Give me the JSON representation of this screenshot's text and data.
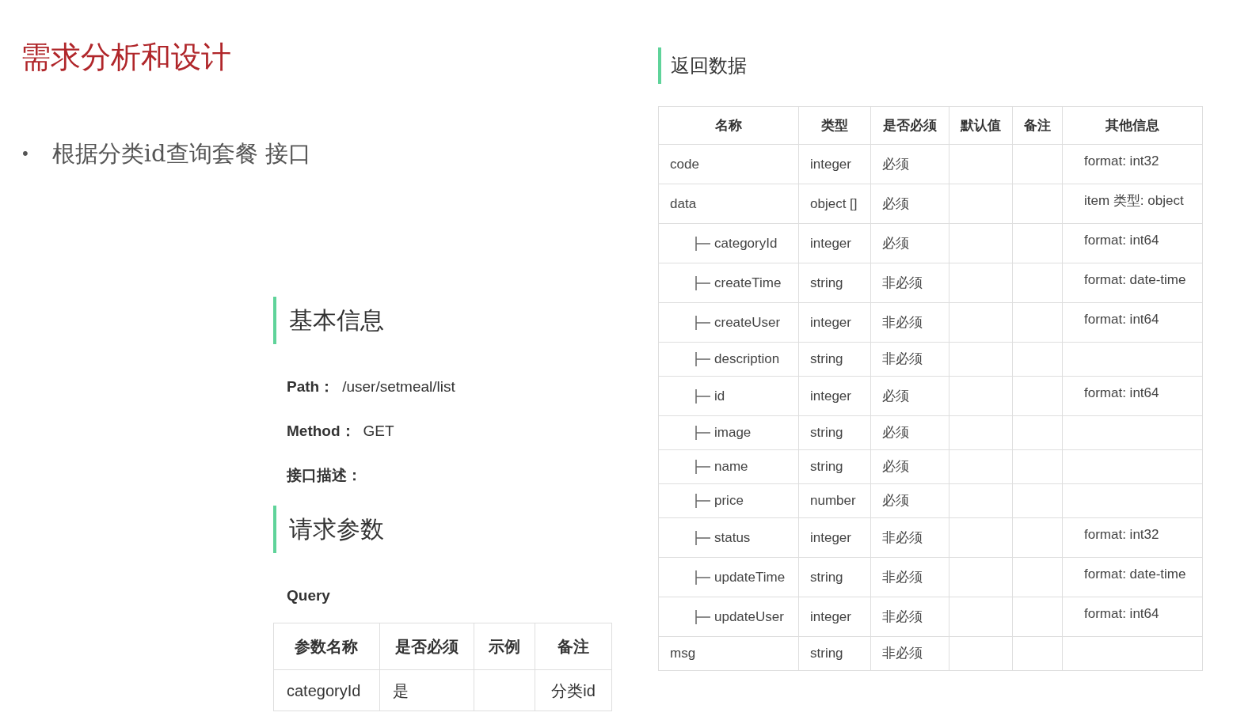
{
  "slide_title": "需求分析和设计",
  "bullet": {
    "marker": "•",
    "text": "根据分类id查询套餐 接口"
  },
  "basic_info": {
    "heading": "基本信息",
    "fields": [
      {
        "label": "Path：",
        "value": "/user/setmeal/list"
      },
      {
        "label": "Method：",
        "value": "GET"
      },
      {
        "label": "接口描述："
      }
    ]
  },
  "request_params": {
    "heading": "请求参数",
    "subheading": "Query",
    "columns": [
      "参数名称",
      "是否必须",
      "示例",
      "备注"
    ],
    "rows": [
      [
        "categoryId",
        "是",
        "",
        "分类id"
      ]
    ]
  },
  "response": {
    "heading": "返回数据",
    "columns": [
      "名称",
      "类型",
      "是否必须",
      "默认值",
      "备注",
      "其他信息"
    ],
    "rows": [
      {
        "name": "code",
        "type": "integer",
        "required": "必须",
        "other": "format: int32"
      },
      {
        "name": "data",
        "type": "object []",
        "required": "必须",
        "other": "item 类型: object",
        "children": [
          {
            "name": "categoryId",
            "type": "integer",
            "required": "必须",
            "other": "format: int64"
          },
          {
            "name": "createTime",
            "type": "string",
            "required": "非必须",
            "other": "format: date-time"
          },
          {
            "name": "createUser",
            "type": "integer",
            "required": "非必须",
            "other": "format: int64"
          },
          {
            "name": "description",
            "type": "string",
            "required": "非必须"
          },
          {
            "name": "id",
            "type": "integer",
            "required": "必须",
            "other": "format: int64"
          },
          {
            "name": "image",
            "type": "string",
            "required": "必须"
          },
          {
            "name": "name",
            "type": "string",
            "required": "必须"
          },
          {
            "name": "price",
            "type": "number",
            "required": "必须"
          },
          {
            "name": "status",
            "type": "integer",
            "required": "非必须",
            "other": "format: int32"
          },
          {
            "name": "updateTime",
            "type": "string",
            "required": "非必须",
            "other": "format: date-time"
          },
          {
            "name": "updateUser",
            "type": "integer",
            "required": "非必须",
            "other": "format: int64"
          }
        ]
      },
      {
        "name": "msg",
        "type": "string",
        "required": "非必须"
      }
    ]
  }
}
